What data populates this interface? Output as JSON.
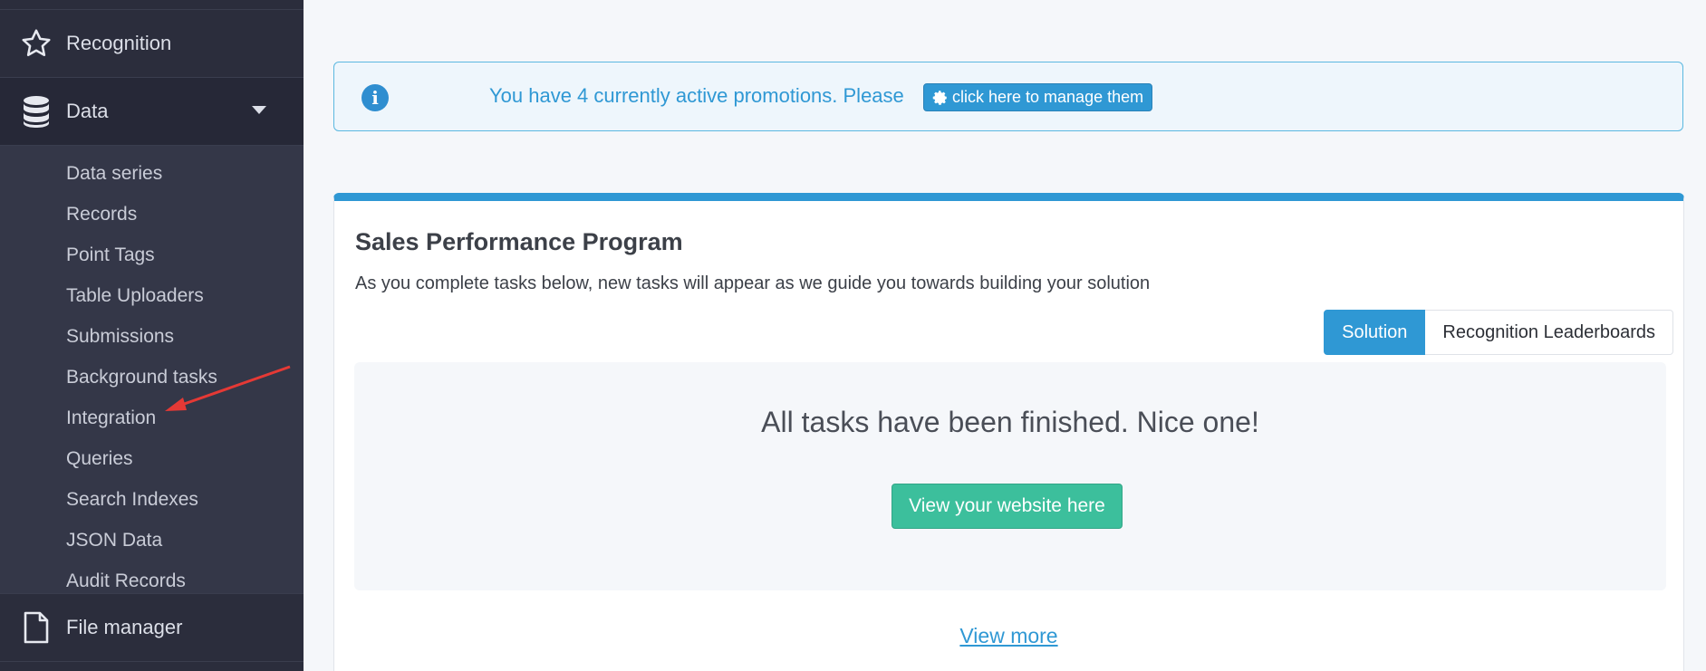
{
  "sidebar": {
    "recognition_label": "Recognition",
    "data_label": "Data",
    "submenu": [
      "Data series",
      "Records",
      "Point Tags",
      "Table Uploaders",
      "Submissions",
      "Background tasks",
      "Integration",
      "Queries",
      "Search Indexes",
      "JSON Data",
      "Audit Records"
    ],
    "file_manager_label": "File manager"
  },
  "alert": {
    "text": "You have 4 currently active promotions. Please",
    "button_label": "click here to manage them"
  },
  "card": {
    "title": "Sales Performance Program",
    "subtitle": "As you complete tasks below, new tasks will appear as we guide you towards building your solution",
    "tabs": [
      "Solution",
      "Recognition Leaderboards"
    ],
    "done_message": "All tasks have been finished. Nice one!",
    "view_site_label": "View your website here",
    "view_more_label": "View more"
  },
  "colors": {
    "sidebar_bg": "#2b2d3c",
    "accent": "#2f98d4",
    "success": "#3cbf9c",
    "annotation": "#e53935"
  },
  "icons": [
    "star-icon",
    "database-icon",
    "chevron-down-icon",
    "file-icon",
    "info-icon",
    "gear-icon"
  ]
}
